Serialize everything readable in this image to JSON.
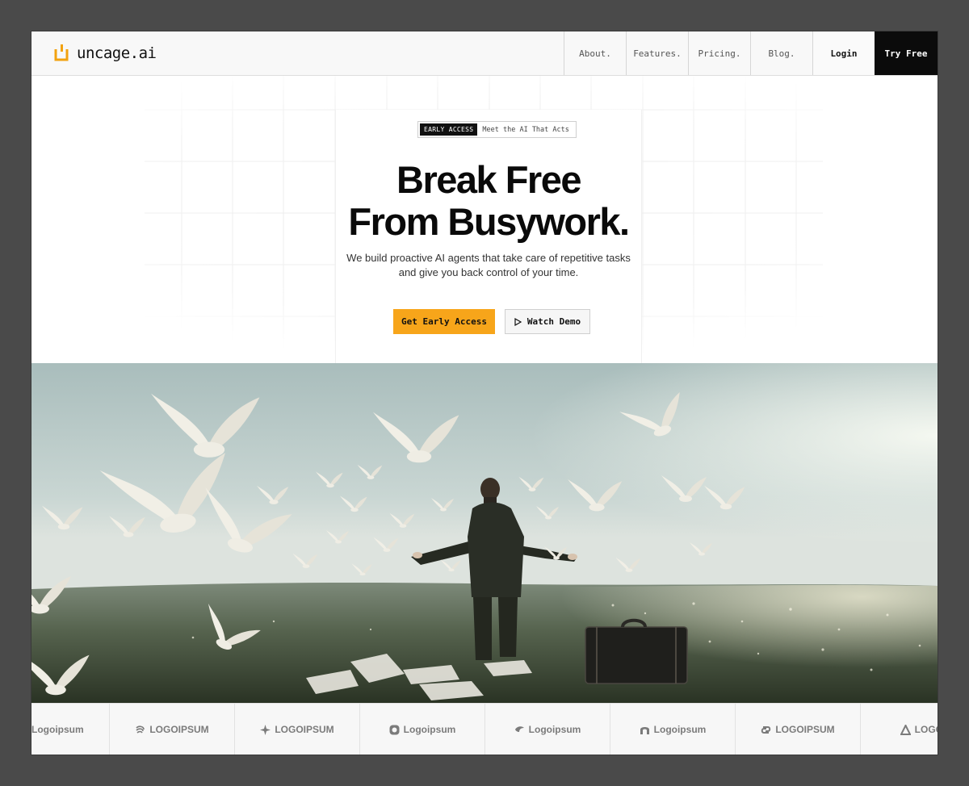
{
  "nav": {
    "brand": "uncage.ai",
    "links": [
      "About.",
      "Features.",
      "Pricing.",
      "Blog."
    ],
    "login": "Login",
    "try_free": "Try Free"
  },
  "hero": {
    "badge_tag": "EARLY ACCESS",
    "badge_text": "Meet the AI That Acts",
    "headline_line1": "Break Free",
    "headline_line2": "From Busywork.",
    "subtitle": "We build proactive AI agents that take care of repetitive tasks and give you back control of your time.",
    "cta_primary": "Get Early Access",
    "cta_secondary": "Watch Demo"
  },
  "logos": [
    {
      "text": "Logoipsum",
      "icon": "none"
    },
    {
      "text": "LOGOIPSUM",
      "icon": "swirl-icon"
    },
    {
      "text": "LOGOIPSUM",
      "icon": "star-cross-icon"
    },
    {
      "text": "Logoipsum",
      "icon": "rounded-c-icon"
    },
    {
      "text": "Logoipsum",
      "icon": "wing-icon"
    },
    {
      "text": "Logoipsum",
      "icon": "arch-icon"
    },
    {
      "text": "LOGOIPSUM",
      "icon": "loop-icon"
    },
    {
      "text": "LOGOI",
      "icon": "triangle-icon"
    }
  ],
  "colors": {
    "accent": "#f7a51a",
    "dark": "#0b0b0b",
    "backdrop": "#4a4a4a"
  }
}
